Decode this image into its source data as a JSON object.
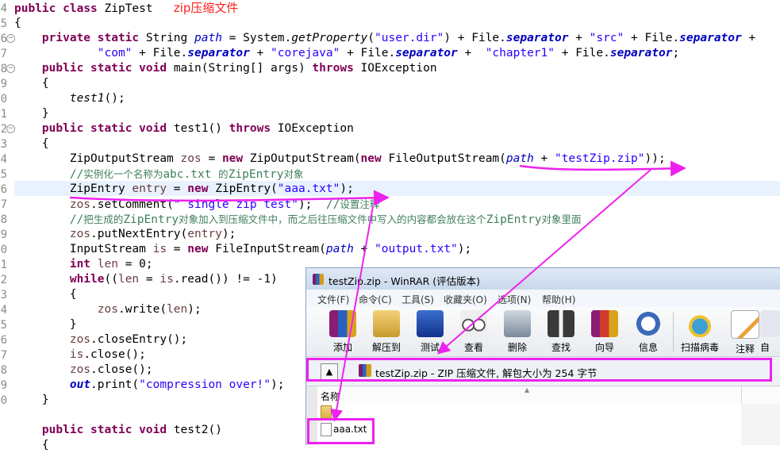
{
  "editor": {
    "line_numbers": [
      "4",
      "5",
      "6",
      "7",
      "8",
      "9",
      "0",
      "1",
      "2",
      "3",
      "4",
      "5",
      "6",
      "7",
      "8",
      "9",
      "0",
      "1",
      "2",
      "3",
      "4",
      "5",
      "6",
      "7",
      "8",
      "9",
      "0"
    ],
    "annotation": "zip压缩文件",
    "lines": {
      "l1": {
        "kw1": "public",
        "kw2": "class",
        "rest": " ZipTest"
      },
      "l2": {
        "text": "{"
      },
      "l3": {
        "kw1": "private",
        "kw2": "static",
        "t1": " String ",
        "fld": "path",
        "t2": " = System.",
        "m": "getProperty",
        "t3": "(",
        "s1": "\"user.dir\"",
        "t4": ") + File.",
        "sf1": "separator",
        "t5": " + ",
        "s2": "\"src\"",
        "t6": " + File.",
        "sf2": "separator",
        "t7": " +"
      },
      "l4": {
        "s1": "\"com\"",
        "t1": " + File.",
        "sf1": "separator",
        "t2": " + ",
        "s2": "\"corejava\"",
        "t3": " + File.",
        "sf2": "separator",
        "t4": " +  ",
        "s3": "\"chapter1\"",
        "t5": " + File.",
        "sf3": "separator",
        "t6": ";"
      },
      "l5": {
        "kw1": "public",
        "kw2": "static",
        "kw3": "void",
        "t1": " main(String[] args) ",
        "kw4": "throws",
        "t2": " IOException"
      },
      "l6": {
        "text": "{"
      },
      "l7": {
        "text": "test1",
        "t2": "();"
      },
      "l8": {
        "text": "}"
      },
      "l9": {
        "kw1": "public",
        "kw2": "static",
        "kw3": "void",
        "t1": " test1() ",
        "kw4": "throws",
        "t2": " IOException"
      },
      "l10": {
        "text": "{"
      },
      "l11": {
        "t1": "ZipOutputStream ",
        "v": "zos",
        "t2": " = ",
        "kw": "new",
        "t3": " ZipOutputStream(",
        "kw2": "new",
        "t4": " FileOutputStream(",
        "fld": "path",
        "t5": " + ",
        "s": "\"testZip.zip\"",
        "t6": "));"
      },
      "l12": {
        "c1": "//",
        "c2": "实例化一个名称为",
        "c3": "abc.txt ",
        "c4": "的",
        "c5": "ZipEntry",
        "c6": "对象"
      },
      "l13": {
        "t1": "ZipEntry ",
        "v": "entry",
        "t2": " = ",
        "kw": "new",
        "t3": " ZipEntry(",
        "s": "\"aaa.txt\"",
        "t4": ");"
      },
      "l14": {
        "v": "zos",
        "t1": ".setComment(",
        "s": "\" single zip test\"",
        "t2": ");  ",
        "c1": "//",
        "c2": "设置注释"
      },
      "l15": {
        "c1": "//",
        "c2": "把生成的",
        "c3": "ZipEntry",
        "c4": "对象加入到压缩文件中，而之后往压缩文件中写入的内容都会放在这个",
        "c5": "ZipEntry",
        "c6": "对象里面"
      },
      "l16": {
        "v": "zos",
        "t1": ".putNextEntry(",
        "v2": "entry",
        "t2": ");"
      },
      "l17": {
        "t1": "InputStream ",
        "v": "is",
        "t2": " = ",
        "kw": "new",
        "t3": " FileInputStream(",
        "fld": "path",
        "t4": " + ",
        "s": "\"output.txt\"",
        "t5": ");"
      },
      "l18": {
        "kw": "int",
        "t1": " ",
        "v": "len",
        "t2": " = 0;"
      },
      "l19": {
        "kw": "while",
        "t1": "((",
        "v": "len",
        "t2": " = ",
        "v2": "is",
        "t3": ".read()) != -1)"
      },
      "l20": {
        "text": "{"
      },
      "l21": {
        "v": "zos",
        "t1": ".write(",
        "v2": "len",
        "t2": ");"
      },
      "l22": {
        "text": "}"
      },
      "l23": {
        "v": "zos",
        "t1": ".closeEntry();"
      },
      "l24": {
        "v": "is",
        "t1": ".close();"
      },
      "l25": {
        "v": "zos",
        "t1": ".close();"
      },
      "l26": {
        "sf": "out",
        "t1": ".print(",
        "s": "\"compression over!\"",
        "t2": ");"
      },
      "l27": {
        "text": "}"
      },
      "l28": {
        "kw1": "public",
        "kw2": "static",
        "kw3": "void",
        "t1": " test2()"
      },
      "l29": {
        "text": "{"
      }
    }
  },
  "winrar": {
    "title": "testZip.zip - WinRAR (评估版本)",
    "menus": [
      "文件(F)",
      "命令(C)",
      "工具(S)",
      "收藏夹(O)",
      "选项(N)",
      "帮助(H)"
    ],
    "toolbar": [
      {
        "label": "添加",
        "icon": "add-books-icon"
      },
      {
        "label": "解压到",
        "icon": "extract-folder-icon"
      },
      {
        "label": "测试",
        "icon": "test-book-icon"
      },
      {
        "label": "查看",
        "icon": "view-glasses-icon"
      },
      {
        "label": "删除",
        "icon": "delete-recycle-icon"
      },
      {
        "label": "查找",
        "icon": "find-binoculars-icon"
      },
      {
        "label": "向导",
        "icon": "wizard-icon"
      },
      {
        "label": "信息",
        "icon": "info-icon"
      },
      {
        "label": "扫描病毒",
        "icon": "virus-scan-icon"
      },
      {
        "label": "注释",
        "icon": "comment-icon"
      },
      {
        "label": "自",
        "icon": "sfx-icon"
      }
    ],
    "path_text": "testZip.zip - ZIP 压缩文件, 解包大小为 254 字节",
    "column_name": "名称",
    "files": [
      "..",
      "aaa.txt"
    ]
  },
  "colors": {
    "highlight": "#ee22ee",
    "keyword": "#7f0055",
    "string": "#2a00ff",
    "comment": "#3f7f5f",
    "field": "#0000c0",
    "annotation": "#ff2020"
  }
}
